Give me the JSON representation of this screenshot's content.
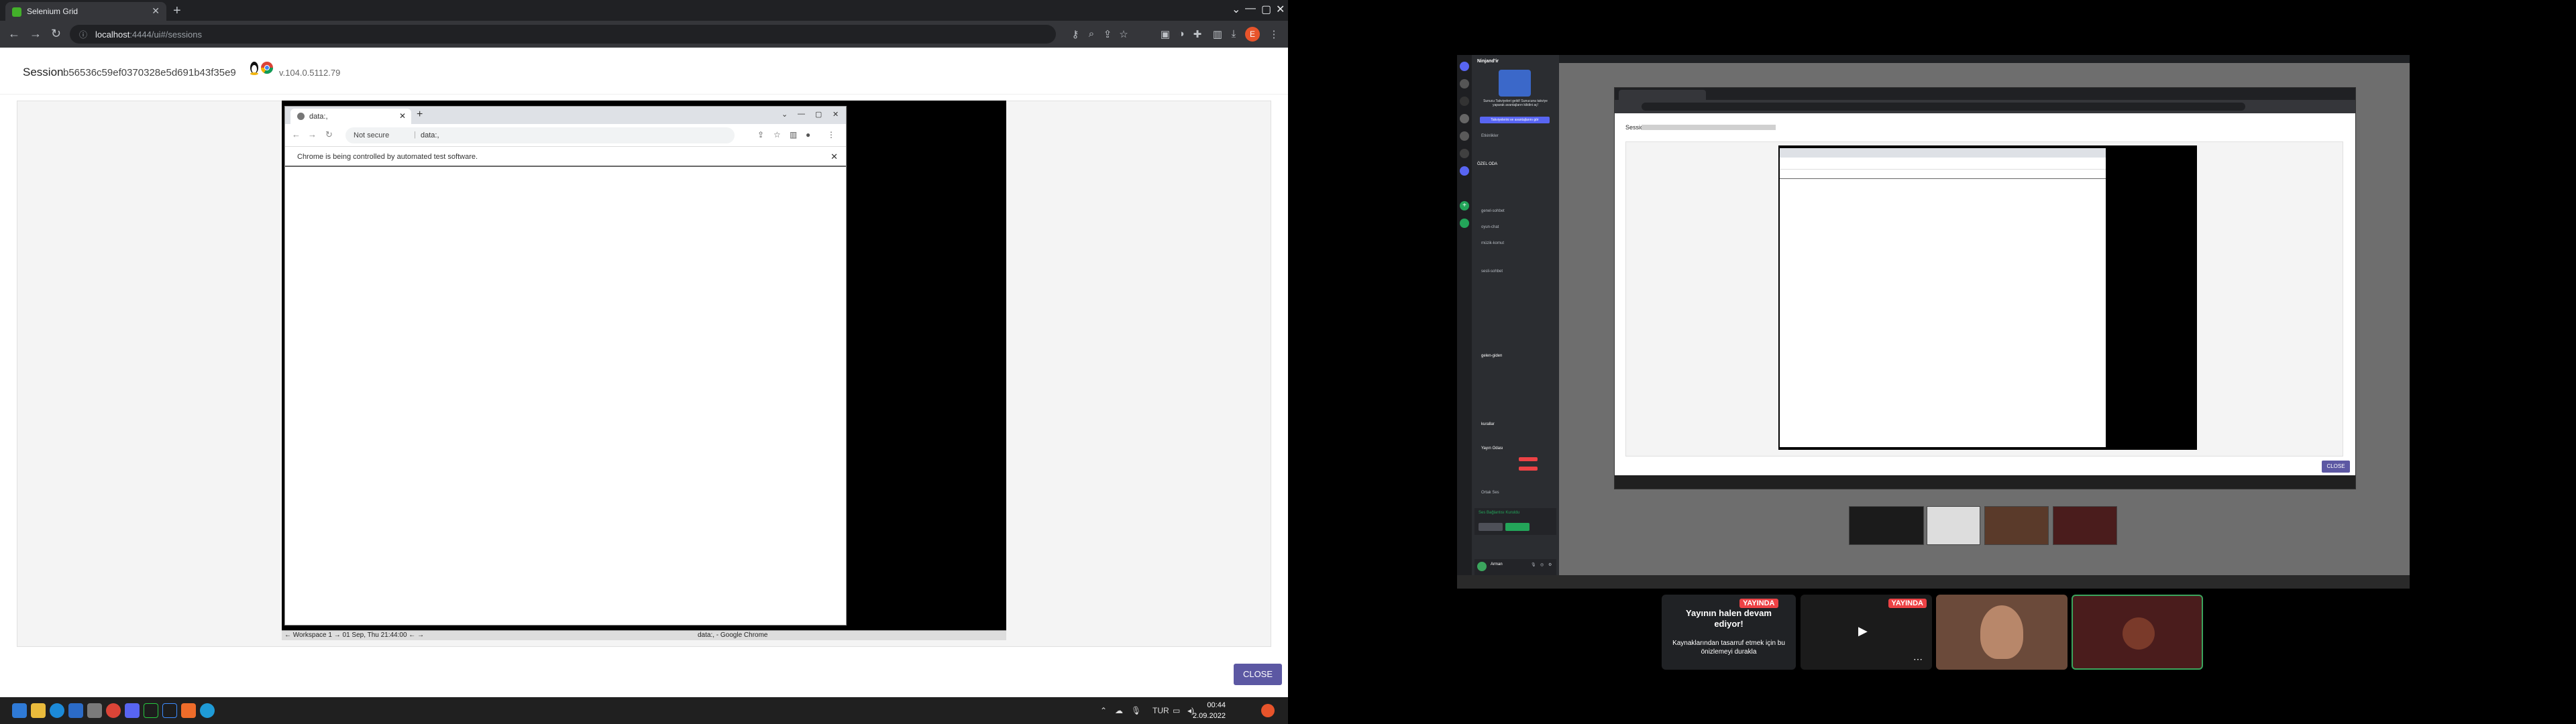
{
  "browser": {
    "tab_title": "Selenium Grid",
    "address": "localhost:4444/ui#/sessions",
    "address_host": "localhost",
    "address_rest": ":4444/ui#/sessions",
    "profile_initial": "E"
  },
  "page": {
    "session_label": "Session",
    "session_id": "b56536c59ef0370328e5d691b43f35e9",
    "browser_version": "v.104.0.5112.79",
    "close_label": "CLOSE"
  },
  "vnc": {
    "tab_title": "data:,",
    "not_secure": "Not secure",
    "url": "data:,",
    "info_bar": "Chrome is being controlled by automated test software.",
    "status_left": "← Workspace 1 →  01 Sep, Thu 21:44:00  ← →",
    "status_center": "data:, - Google Chrome"
  },
  "taskbar": {
    "lang": "TUR",
    "time": "00:44",
    "date": "2.09.2022"
  },
  "discord": {
    "server_name": "Ninjand'ir",
    "promo_text": "Sunucu Takviyeleri geldi! Sunucuna takviye yaparak avantajların kilidini aç!",
    "promo_button": "Takviyelerini ve avantajlarını gör",
    "channels": [
      "Etkinlikler",
      "ÖZEL ODA",
      "genel-sohbet",
      "oyun-chat",
      "müzik-komut",
      "sesli-sohbet",
      "gelen-giden",
      "kurallar",
      "Yayın Odası",
      "Ortak Ses"
    ],
    "user_name": "Arman",
    "status_name": "Ses Bağlantısı Kuruldu"
  },
  "stream": {
    "live_badge": "YAYINDA",
    "info_title": "Yayının halen devam ediyor!",
    "info_text": "Kaynaklarından tasarruf etmek için bu önizlemeyi durakla"
  },
  "nested": {
    "session_label": "Session",
    "close_label": "CLOSE"
  },
  "colors": {
    "close_button": "#5c58a3",
    "chrome_dark": "#202124",
    "live_red": "#ed4245",
    "speaking_green": "#3ba55d"
  }
}
